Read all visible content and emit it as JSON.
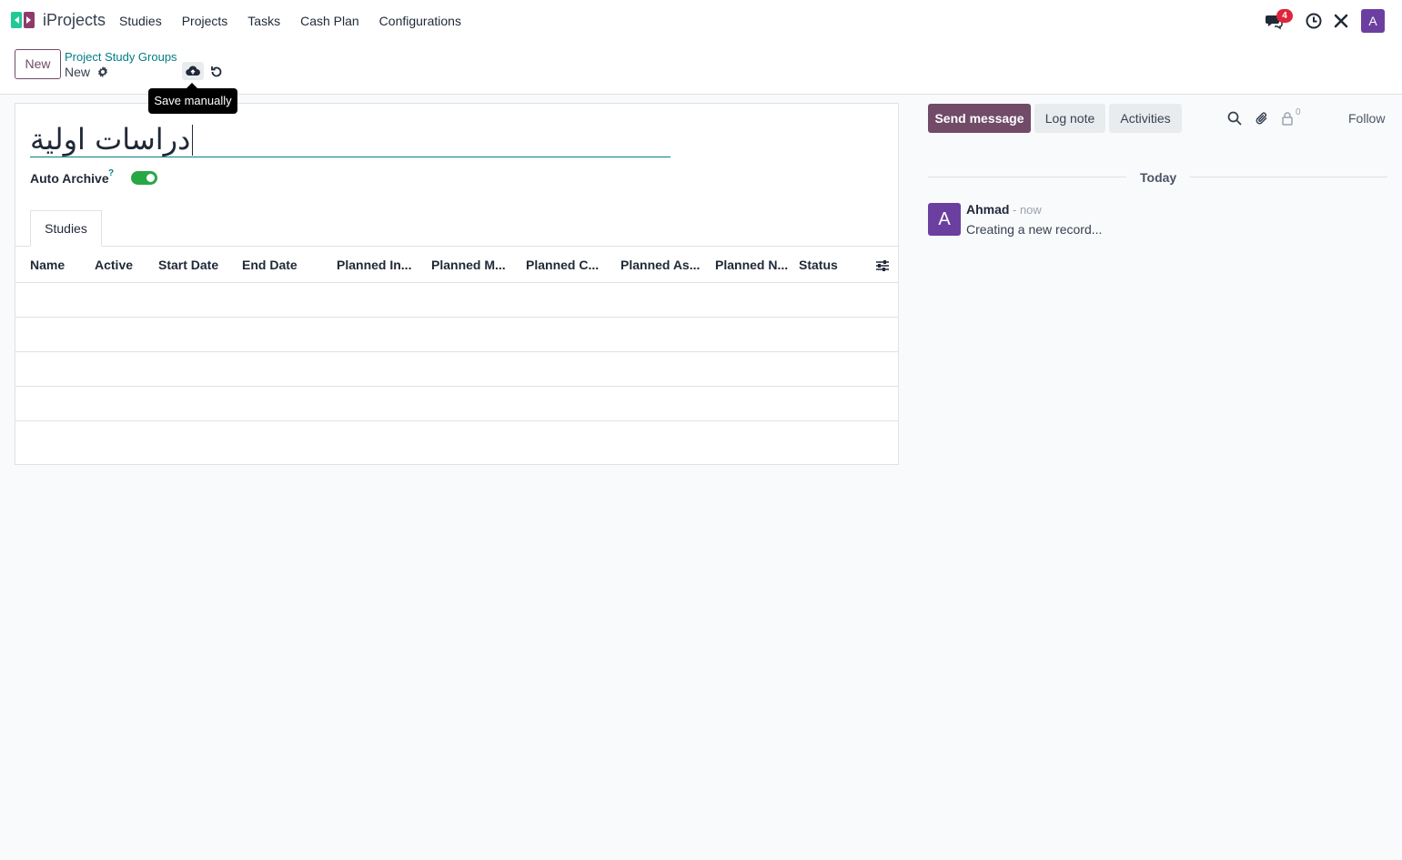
{
  "app": {
    "name": "iProjects"
  },
  "nav": {
    "items": [
      {
        "label": "Studies"
      },
      {
        "label": "Projects"
      },
      {
        "label": "Tasks"
      },
      {
        "label": "Cash Plan"
      },
      {
        "label": "Configurations"
      }
    ]
  },
  "systray": {
    "messages_count": "4",
    "user_initial": "A",
    "icons": [
      "chat-icon",
      "clock-icon",
      "tools-icon"
    ]
  },
  "control_panel": {
    "new_label": "New",
    "breadcrumb": "Project Study Groups",
    "record_name": "New",
    "save_tooltip": "Save manually"
  },
  "form": {
    "title_value": "دراسات اولية",
    "auto_archive_label": "Auto Archive",
    "help_mark": "?",
    "auto_archive_enabled": true,
    "tab_label": "Studies",
    "columns": [
      "Name",
      "Active",
      "Start Date",
      "End Date",
      "Planned In...",
      "Planned M...",
      "Planned C...",
      "Planned As...",
      "Planned N...",
      "Status"
    ]
  },
  "chatter": {
    "send_message": "Send message",
    "log_note": "Log note",
    "activities": "Activities",
    "followers_count": "0",
    "follow": "Follow",
    "date_separator": "Today",
    "message": {
      "avatar_initial": "A",
      "author": "Ahmad",
      "time": "- now",
      "body": "Creating a new record..."
    }
  },
  "colors": {
    "brand": "#714b67",
    "accent": "#017e84",
    "toggle_on": "#28a745",
    "badge": "#e0243a",
    "avatar": "#6b3fa0"
  }
}
